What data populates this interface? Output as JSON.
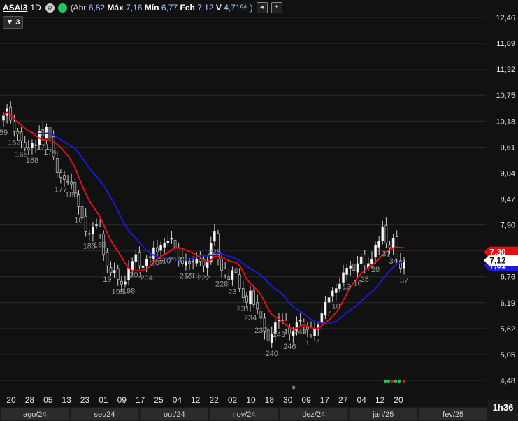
{
  "header": {
    "symbol": "ASAI3",
    "timeframe": "1D",
    "ohlc_open_prefix": "(Abr",
    "open": "6,82",
    "high_label": "Máx",
    "high": "7,16",
    "low_label": "Mín",
    "low": "6,77",
    "close_label": "Fch",
    "close": "7,12",
    "var_label": "V",
    "variation": "4,71% )",
    "gear_icon": "gear-icon",
    "live_icon": "live-status-icon"
  },
  "indicator_badge": "▼ 3",
  "corner_label": "1h36",
  "colors": {
    "background": "#111111",
    "grid": "#2a2a2a",
    "candle_up": "#ffffff",
    "candle_down": "#111111",
    "ma_fast": "#e01010",
    "ma_slow": "#1a1ad8",
    "label_red": "#e01010",
    "label_blue": "#1a1ad8"
  },
  "chart_data": {
    "type": "candlestick",
    "price_axis_ticks": [
      "12,46",
      "11,89",
      "11,32",
      "10,75",
      "10,18",
      "9,61",
      "9,04",
      "8,47",
      "7,90",
      "7,33",
      "6,76",
      "6,19",
      "5,62",
      "5,05",
      "4,48"
    ],
    "price_labels": {
      "last": "7,12",
      "ma_fast": "7,30",
      "ma_slow": "7,01"
    },
    "day_ticks": [
      "20",
      "28",
      "05",
      "13",
      "23",
      "01",
      "09",
      "17",
      "25",
      "04",
      "12",
      "22",
      "02",
      "10",
      "18",
      "30",
      "09",
      "17",
      "27",
      "04",
      "12",
      "20"
    ],
    "month_labels": [
      "ago/24",
      "set/24",
      "out/24",
      "nov/24",
      "dez/24",
      "jan/25",
      "fev/25"
    ],
    "candle_annotations": [
      "59",
      "162",
      "165",
      "168",
      "171",
      "174",
      "177",
      "180",
      "18",
      "183",
      "186",
      "19",
      "195",
      "198",
      "201",
      "204",
      "207",
      "210",
      "213",
      "216",
      "219",
      "222",
      "225",
      "228",
      "23",
      "231",
      "234",
      "237",
      "240",
      "243",
      "246",
      "249",
      "1",
      "4",
      "7",
      "10",
      "13",
      "16",
      "25",
      "28",
      "31",
      "34",
      "37"
    ],
    "closes": [
      10.3,
      10.45,
      10.2,
      9.95,
      9.9,
      9.75,
      9.6,
      9.55,
      9.7,
      9.65,
      9.95,
      9.85,
      10.05,
      9.8,
      9.4,
      9.05,
      8.95,
      8.9,
      8.85,
      8.8,
      8.6,
      8.3,
      8.05,
      7.75,
      7.7,
      7.85,
      7.9,
      7.7,
      7.25,
      7.0,
      6.85,
      6.9,
      6.7,
      6.6,
      6.65,
      6.95,
      7.1,
      7.25,
      7.0,
      7.0,
      7.15,
      7.2,
      7.4,
      7.3,
      7.45,
      7.5,
      7.55,
      7.6,
      7.4,
      7.15,
      7.05,
      7.1,
      7.05,
      7.1,
      7.15,
      7.1,
      7.0,
      7.1,
      7.5,
      7.75,
      7.15,
      6.9,
      6.8,
      6.7,
      6.9,
      6.85,
      6.5,
      6.3,
      6.2,
      6.45,
      6.15,
      6.05,
      5.85,
      5.55,
      5.35,
      5.5,
      5.75,
      5.85,
      5.8,
      5.6,
      5.5,
      5.55,
      5.75,
      5.8,
      5.65,
      5.6,
      5.5,
      5.6,
      5.7,
      5.95,
      6.2,
      6.3,
      6.45,
      6.5,
      6.6,
      6.85,
      6.95,
      7.0,
      6.9,
      7.05,
      7.2,
      7.0,
      7.05,
      7.15,
      7.45,
      7.55,
      7.85,
      7.5,
      7.4,
      7.6,
      7.15,
      6.95,
      7.12
    ],
    "ylim": [
      4.48,
      12.46
    ]
  }
}
